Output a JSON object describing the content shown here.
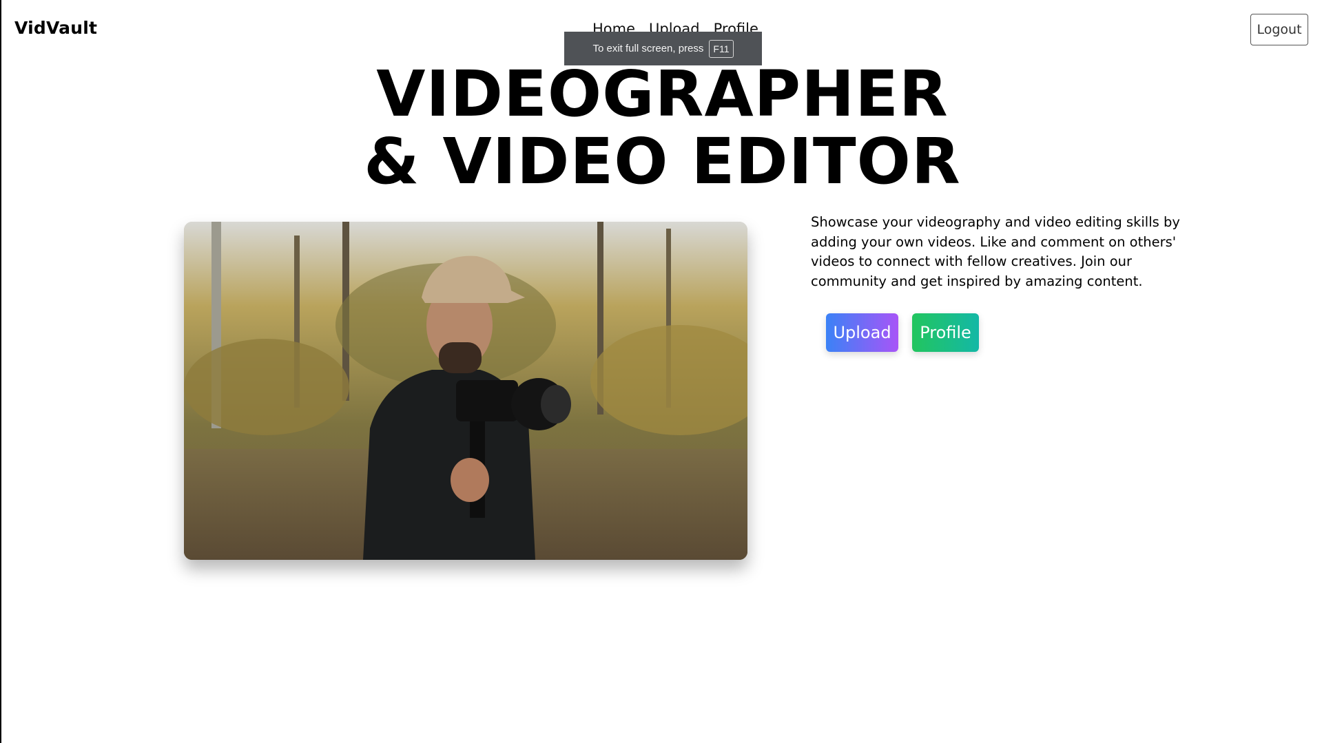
{
  "header": {
    "brand": "VidVault",
    "nav": [
      {
        "label": "Home"
      },
      {
        "label": "Upload"
      },
      {
        "label": "Profile"
      }
    ],
    "logout_label": "Logout"
  },
  "fullscreen_toast": {
    "message": "To exit full screen, press",
    "key": "F11"
  },
  "hero": {
    "headline_line1": "VIDEOGRAPHER",
    "headline_line2": "& VIDEO EDITOR",
    "image_alt": "Videographer holding a camera on a gimbal in an autumn forest",
    "description": "Showcase your videography and video editing skills by adding your own videos. Like and comment on others' videos to connect with fellow creatives. Join our community and get inspired by amazing content.",
    "upload_button": "Upload",
    "profile_button": "Profile"
  },
  "colors": {
    "upload_gradient": [
      "#3b82f6",
      "#a855f7"
    ],
    "profile_gradient": [
      "#22c55e",
      "#14b8a6"
    ],
    "toast_bg": "#4f5256"
  }
}
